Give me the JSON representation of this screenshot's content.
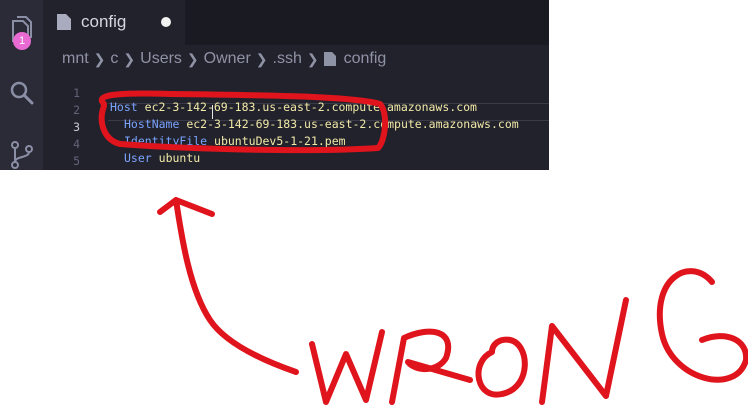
{
  "activity_bar": {
    "explorer_badge": "1",
    "icons": [
      "files-icon",
      "search-icon",
      "source-control-icon"
    ]
  },
  "tab": {
    "label": "config",
    "dirty": true
  },
  "breadcrumb": [
    "mnt",
    "c",
    "Users",
    "Owner",
    ".ssh",
    "config"
  ],
  "editor": {
    "active_line": 3,
    "lines": [
      {
        "num": "1",
        "key": "Host",
        "value": "ec2-3-142-69-183.us-east-2.compute.amazonaws.com"
      },
      {
        "num": "2",
        "key": "HostName",
        "value": "ec2-3-142-69-183.us-east-2.compute.amazonaws.com"
      },
      {
        "num": "3",
        "key": "IdentityFile",
        "value": "ubuntuDev5-1-21.pem"
      },
      {
        "num": "4",
        "key": "User",
        "value": "ubuntu"
      },
      {
        "num": "5",
        "key": "",
        "value": ""
      }
    ]
  },
  "annotation": {
    "text": "WRONG",
    "color": "#e0141c"
  }
}
